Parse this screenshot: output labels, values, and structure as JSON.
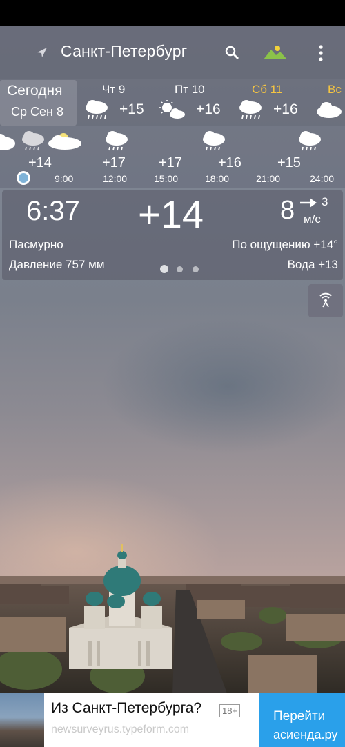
{
  "header": {
    "city": "Санкт-Петербург",
    "icons": [
      "navigation-arrow-icon",
      "search-icon",
      "landscape-icon",
      "more-vert-icon"
    ]
  },
  "days": {
    "today_label": "Сегодня",
    "today_date": "Ср Сен 8",
    "items": [
      {
        "name": "Чт 9",
        "temp": "+15",
        "icon": "rain-cloud-icon",
        "color": "#ffffff"
      },
      {
        "name": "Пт 10",
        "temp": "+16",
        "icon": "sun-cloud-icon",
        "color": "#ffffff"
      },
      {
        "name": "Сб 11",
        "temp": "+16",
        "icon": "rain-cloud-icon",
        "color": "#f5c542"
      },
      {
        "name": "Вс",
        "temp": "",
        "icon": "cloud-icon",
        "color": "#f5c542"
      }
    ]
  },
  "hours": {
    "items": [
      {
        "temp": "+14",
        "time": "9:00",
        "icon": "rain-sun-cloud-icon"
      },
      {
        "temp": "+17",
        "time": "12:00",
        "icon": "rain-cloud-icon"
      },
      {
        "temp": "+17",
        "time": "15:00",
        "icon": ""
      },
      {
        "temp": "+16",
        "time": "18:00",
        "icon": "rain-cloud-icon"
      },
      {
        "temp": "+15",
        "time": "21:00",
        "icon": ""
      },
      {
        "temp": "",
        "time": "24:00",
        "icon": "rain-cloud-icon"
      }
    ]
  },
  "current": {
    "time": "6:37",
    "temp": "+14",
    "wind_speed": "8",
    "wind_gust": "3",
    "wind_unit": "м/с",
    "condition": "Пасмурно",
    "feels_like": "По ощущению +14°",
    "pressure": "Давление 757 мм",
    "water": "Вода +13"
  },
  "ad": {
    "title": "Из Санкт-Петербурга?",
    "age": "18+",
    "url": "newsurveyrus.typeform.com",
    "button": "Перейти",
    "button_color": "#2aa0ea"
  },
  "watermark": "асиенда.ру"
}
